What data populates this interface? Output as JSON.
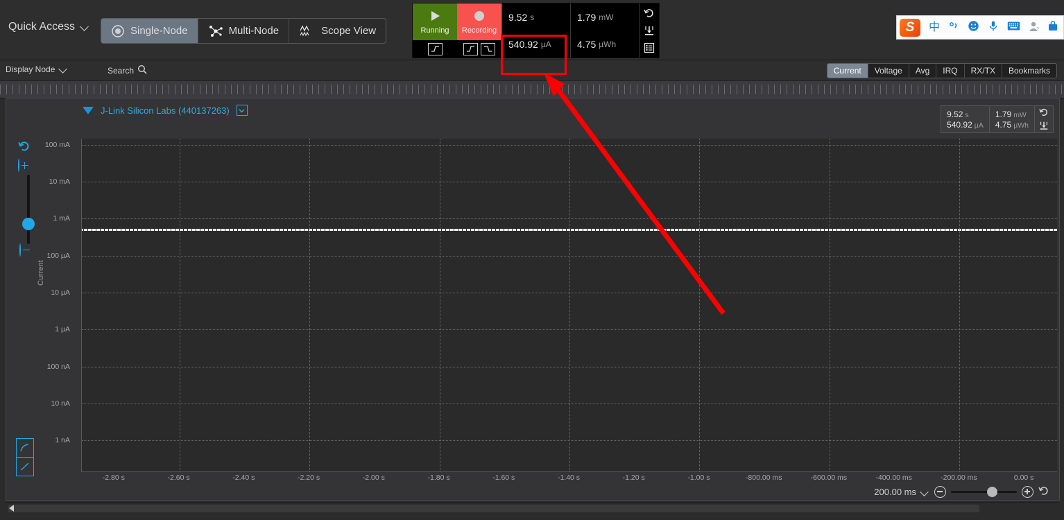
{
  "toolbar": {
    "quick_access": "Quick Access",
    "modes": [
      {
        "label": "Single-Node",
        "icon": "single-node-icon",
        "selected": true
      },
      {
        "label": "Multi-Node",
        "icon": "multi-node-icon",
        "selected": false
      },
      {
        "label": "Scope View",
        "icon": "scope-view-icon",
        "selected": false
      }
    ],
    "run_button": "Running",
    "record_button": "Recording",
    "readouts": [
      {
        "value": "9.52",
        "unit": "s"
      },
      {
        "value": "540.92",
        "unit": "µA"
      },
      {
        "value": "1.79",
        "unit": "mW"
      },
      {
        "value": "4.75",
        "unit": "µWh"
      }
    ],
    "action_icons": [
      "reset-icon",
      "save-icon",
      "list-icon"
    ],
    "trigger_icons": [
      "rising-edge-icon",
      "rising-edge-icon",
      "falling-edge-icon"
    ]
  },
  "tray": {
    "logo": "S",
    "icons": [
      "chinese-input-icon",
      "punctuation-icon",
      "emoji-icon",
      "microphone-icon",
      "keyboard-icon",
      "user-icon",
      "toolbox-icon"
    ],
    "chinese_label": "中"
  },
  "bar2": {
    "display_node": "Display Node",
    "search": "Search",
    "tabs": [
      {
        "label": "Current",
        "selected": true
      },
      {
        "label": "Voltage",
        "selected": false
      },
      {
        "label": "Avg",
        "selected": false
      },
      {
        "label": "IRQ",
        "selected": false
      },
      {
        "label": "RX/TX",
        "selected": false
      },
      {
        "label": "Bookmarks",
        "selected": false
      }
    ]
  },
  "panel": {
    "device": "J-Link Silicon Labs (440137263)",
    "readouts": [
      {
        "value": "9.52",
        "unit": "s"
      },
      {
        "value": "540.92",
        "unit": "µA"
      },
      {
        "value": "1.79",
        "unit": "mW"
      },
      {
        "value": "4.75",
        "unit": "µWh"
      }
    ],
    "y_axis_label": "Current",
    "zoom_value": "200.00 ms"
  },
  "chart_data": {
    "type": "line",
    "title": "J-Link Silicon Labs (440137263)",
    "xlabel": "",
    "ylabel": "Current",
    "y_scale": "log",
    "y_ticks": [
      "100 mA",
      "10 mA",
      "1 mA",
      "100 µA",
      "10 µA",
      "1 µA",
      "100 nA",
      "10 nA",
      "1 nA"
    ],
    "ylim": [
      "1 nA",
      "100 mA"
    ],
    "x_ticks": [
      "-2.80 s",
      "-2.60 s",
      "-2.40 s",
      "-2.20 s",
      "-2.00 s",
      "-1.80 s",
      "-1.60 s",
      "-1.40 s",
      "-1.20 s",
      "-1.00 s",
      "-800.00 ms",
      "-600.00 ms",
      "-400.00 ms",
      "-200.00 ms",
      "0.00 s"
    ],
    "xlim": [
      -2.9,
      0.0
    ],
    "grid": true,
    "legend": "none",
    "series": [
      {
        "name": "Current",
        "color": "#f0f0f0",
        "constant_value_uA": 540.92,
        "description": "Flat noisy trace near 540.92 µA across the full time window"
      }
    ],
    "annotations": [
      {
        "type": "highlight-box",
        "target": "540.92 µA readout",
        "color": "#ff0000"
      },
      {
        "type": "arrow",
        "from": "plot area",
        "to": "540.92 µA readout",
        "color": "#ff0000"
      }
    ]
  }
}
